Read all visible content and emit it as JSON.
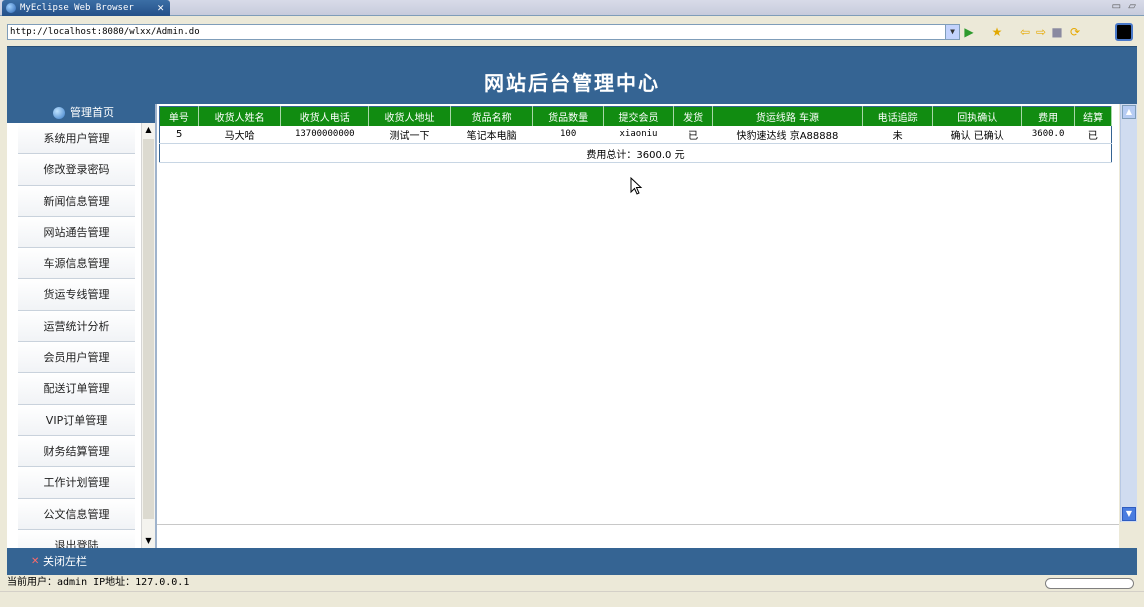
{
  "browser": {
    "tab_title": "MyEclipse Web Browser",
    "url": "http://localhost:8080/wlxx/Admin.do"
  },
  "header": {
    "title": "网站后台管理中心"
  },
  "sidebar": {
    "home_label": "管理首页",
    "items": [
      {
        "label": "系统用户管理"
      },
      {
        "label": "修改登录密码"
      },
      {
        "label": "新闻信息管理"
      },
      {
        "label": "网站通告管理"
      },
      {
        "label": "车源信息管理"
      },
      {
        "label": "货运专线管理"
      },
      {
        "label": "运营统计分析"
      },
      {
        "label": "会员用户管理"
      },
      {
        "label": "配送订单管理"
      },
      {
        "label": "VIP订单管理"
      },
      {
        "label": "财务结算管理"
      },
      {
        "label": "工作计划管理"
      },
      {
        "label": "公文信息管理"
      },
      {
        "label": "退出登陆"
      }
    ]
  },
  "table": {
    "columns": [
      "单号",
      "收货人姓名",
      "收货人电话",
      "收货人地址",
      "货品名称",
      "货品数量",
      "提交会员",
      "发货",
      "货运线路 车源",
      "电话追踪",
      "回执确认",
      "费用",
      "结算"
    ],
    "rows": [
      [
        "5",
        "马大哈",
        "13700000000",
        "测试一下",
        "笔记本电脑",
        "100",
        "xiaoniu",
        "已",
        "快豹速达线 京A88888",
        "未",
        "确认 已确认",
        "3600.0",
        "已"
      ]
    ],
    "total": "费用总计：3600.0 元"
  },
  "footer": {
    "close_sidebar": "关闭左栏",
    "user_info": "当前用户：admin  IP地址：127.0.0.1"
  }
}
